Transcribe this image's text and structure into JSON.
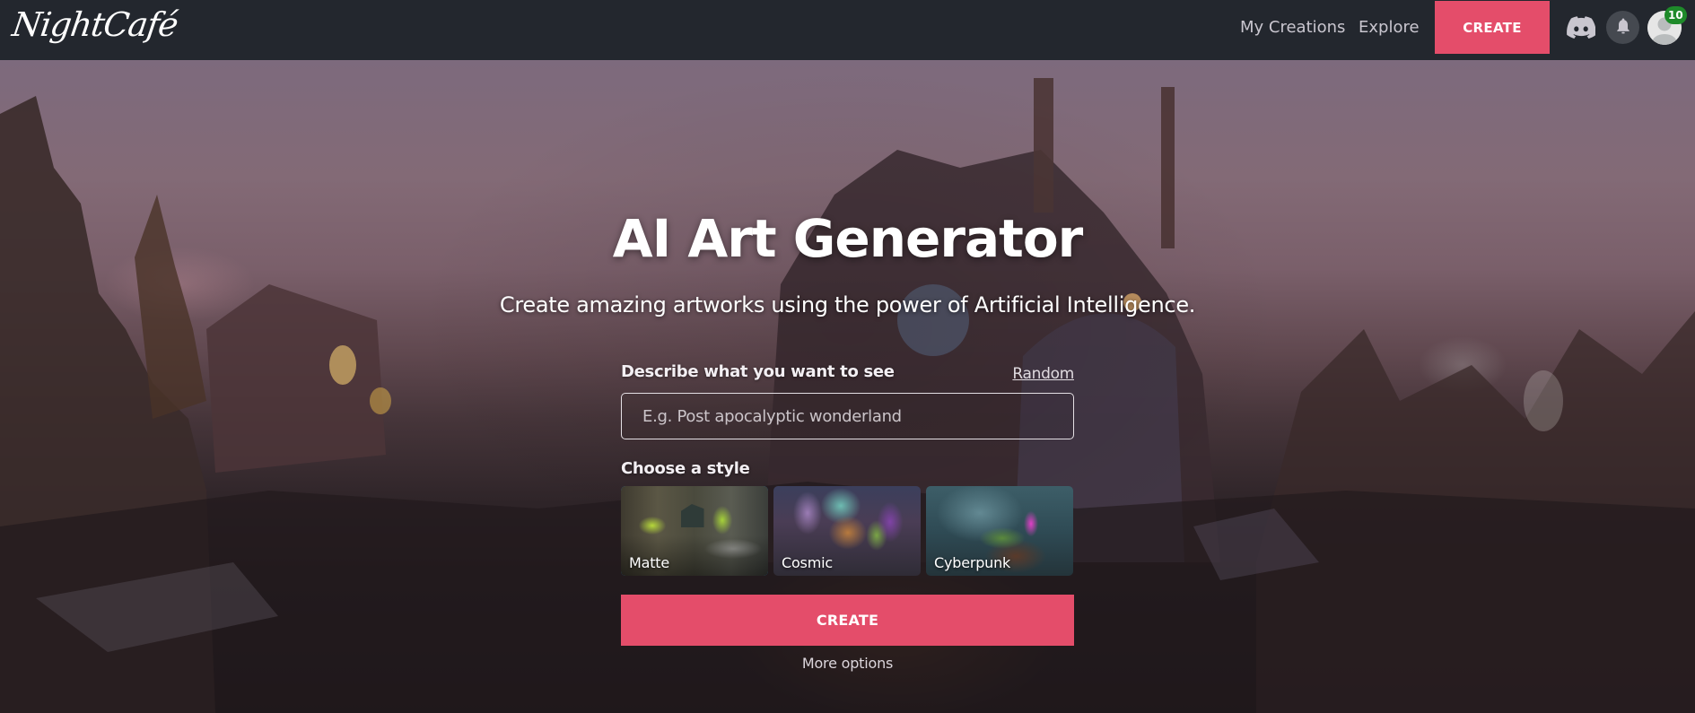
{
  "header": {
    "logo_text": "NightCafé",
    "nav": [
      {
        "label": "My Creations"
      },
      {
        "label": "Explore"
      }
    ],
    "create_label": "CREATE",
    "icons": [
      "discord-icon",
      "bell-icon",
      "avatar-icon"
    ],
    "notification_count": "10"
  },
  "hero": {
    "title": "AI Art Generator",
    "subtitle": "Create amazing artworks using the power of Artificial Intelligence."
  },
  "form": {
    "prompt_label": "Describe what you want to see",
    "random_label": "Random",
    "prompt_value": "",
    "prompt_placeholder": "E.g. Post apocalyptic wonderland",
    "style_label": "Choose a style",
    "styles": [
      {
        "name": "Matte",
        "selected": true
      },
      {
        "name": "Cosmic",
        "selected": false
      },
      {
        "name": "Cyberpunk",
        "selected": false
      }
    ],
    "create_label": "CREATE",
    "more_options_label": "More options"
  },
  "colors": {
    "header_bg": "#23272e",
    "accent": "#e44d6a",
    "selected_border": "#1b7ed0",
    "badge": "#1e8a2a"
  }
}
